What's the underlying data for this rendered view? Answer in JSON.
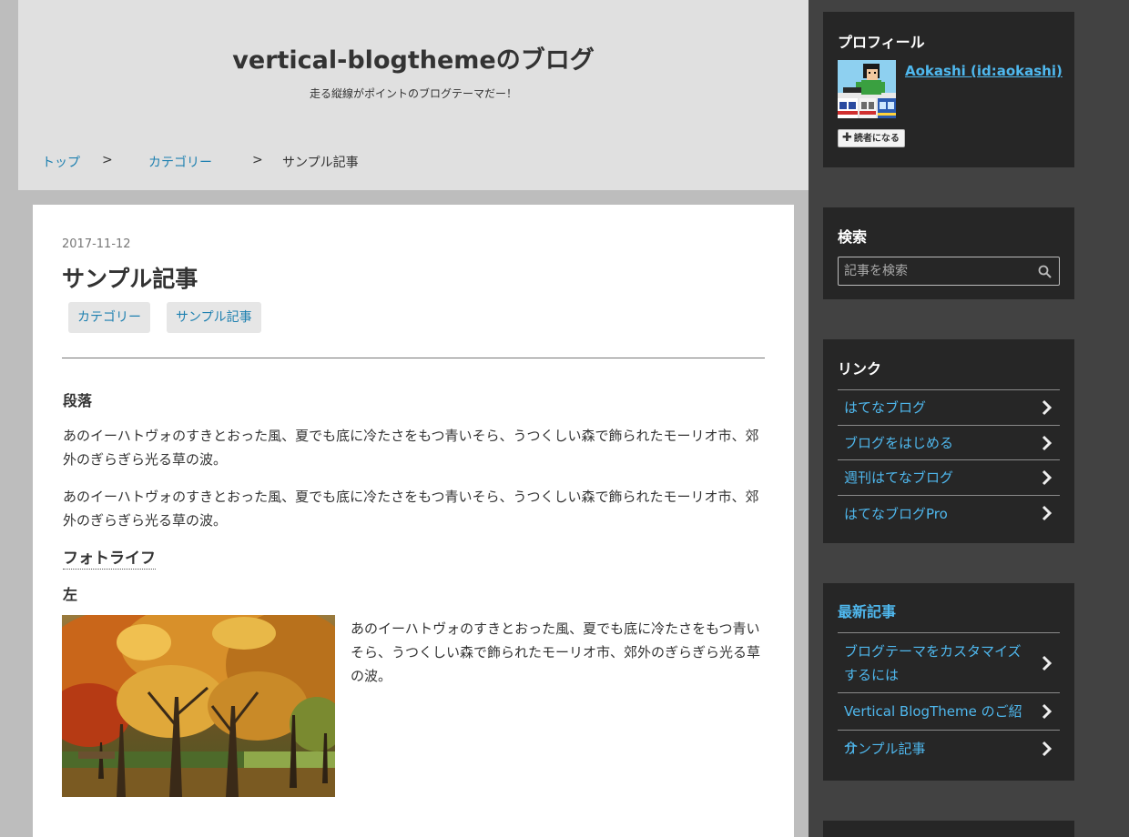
{
  "header": {
    "title": "vertical-blogthemeのブログ",
    "description": "走る縦線がポイントのブログテーマだー！"
  },
  "breadcrumb": {
    "top": "トップ",
    "sep1": ">",
    "category": "カテゴリー",
    "sep2": ">",
    "current": "サンプル記事"
  },
  "article": {
    "date": "2017-11-12",
    "title": "サンプル記事",
    "categories": [
      "カテゴリー",
      "サンプル記事"
    ],
    "section1_heading": "段落",
    "paragraph1": "あのイーハトヴォのすきとおった風、夏でも底に冷たさをもつ青いそら、うつくしい森で飾られたモーリオ市、郊外のぎらぎら光る草の波。",
    "paragraph2": "あのイーハトヴォのすきとおった風、夏でも底に冷たさをもつ青いそら、うつくしい森で飾られたモーリオ市、郊外のぎらぎら光る草の波。",
    "photolife_heading": "フォトライフ",
    "left_heading": "左",
    "photo_text": "あのイーハトヴォのすきとおった風、夏でも底に冷たさをもつ青いそら、うつくしい森で飾られたモーリオ市、郊外のぎらぎら光る草の波。"
  },
  "sidebar": {
    "profile": {
      "title": "プロフィール",
      "name": "Aokashi (id:aokashi)",
      "subscribe": "読者になる"
    },
    "search": {
      "title": "検索",
      "placeholder": "記事を検索"
    },
    "links": {
      "title": "リンク",
      "items": [
        "はてなブログ",
        "ブログをはじめる",
        "週刊はてなブログ",
        "はてなブログPro"
      ]
    },
    "recent": {
      "title": "最新記事",
      "items": [
        "ブログテーマをカスタマイズするには",
        "Vertical BlogTheme のご紹介",
        "サンプル記事"
      ]
    }
  },
  "colors": {
    "link": "#1e80b0",
    "sidebar_link": "#4fb8ee",
    "sidebar_bg": "#424242",
    "module_bg": "#262626",
    "header_bg": "#e0e0e0",
    "page_bg": "#bdbdbd"
  }
}
